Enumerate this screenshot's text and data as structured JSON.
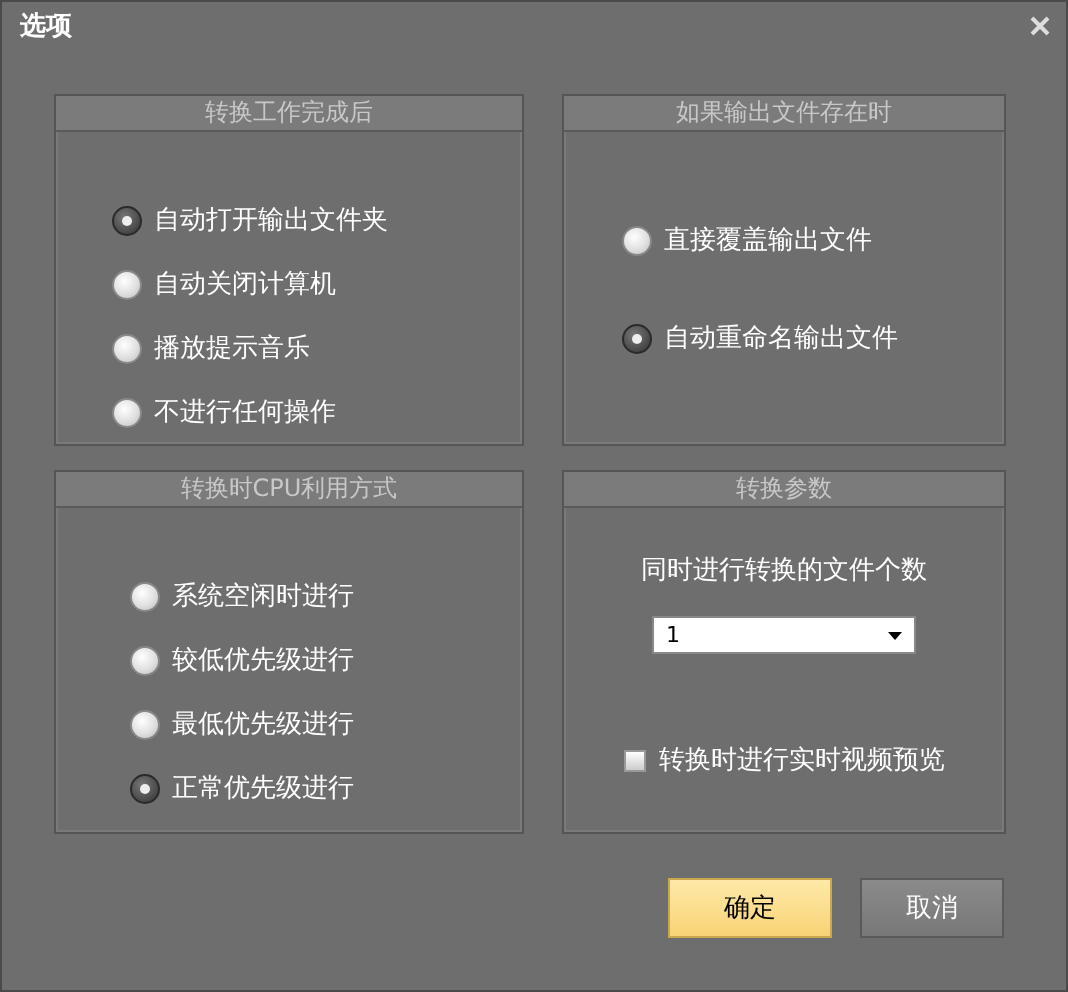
{
  "window": {
    "title": "选项"
  },
  "panels": [
    {
      "kind": "radios",
      "title": "转换工作完成后",
      "options": [
        {
          "label": "自动打开输出文件夹",
          "selected": true
        },
        {
          "label": "自动关闭计算机",
          "selected": false
        },
        {
          "label": "播放提示音乐",
          "selected": false
        },
        {
          "label": "不进行任何操作",
          "selected": false
        }
      ]
    },
    {
      "kind": "radios",
      "title": "如果输出文件存在时",
      "options": [
        {
          "label": "直接覆盖输出文件",
          "selected": false
        },
        {
          "label": "自动重命名输出文件",
          "selected": true
        }
      ]
    },
    {
      "kind": "radios",
      "title": "转换时CPU利用方式",
      "options": [
        {
          "label": "系统空闲时进行",
          "selected": false
        },
        {
          "label": "较低优先级进行",
          "selected": false
        },
        {
          "label": "最低优先级进行",
          "selected": false
        },
        {
          "label": "正常优先级进行",
          "selected": true
        }
      ]
    },
    {
      "kind": "params",
      "title": "转换参数",
      "count_label": "同时进行转换的文件个数",
      "count_value": "1",
      "preview": {
        "label": "转换时进行实时视频预览",
        "checked": false
      }
    }
  ],
  "buttons": [
    {
      "label": "确定",
      "kind": "primary"
    },
    {
      "label": "取消",
      "kind": "normal"
    }
  ]
}
